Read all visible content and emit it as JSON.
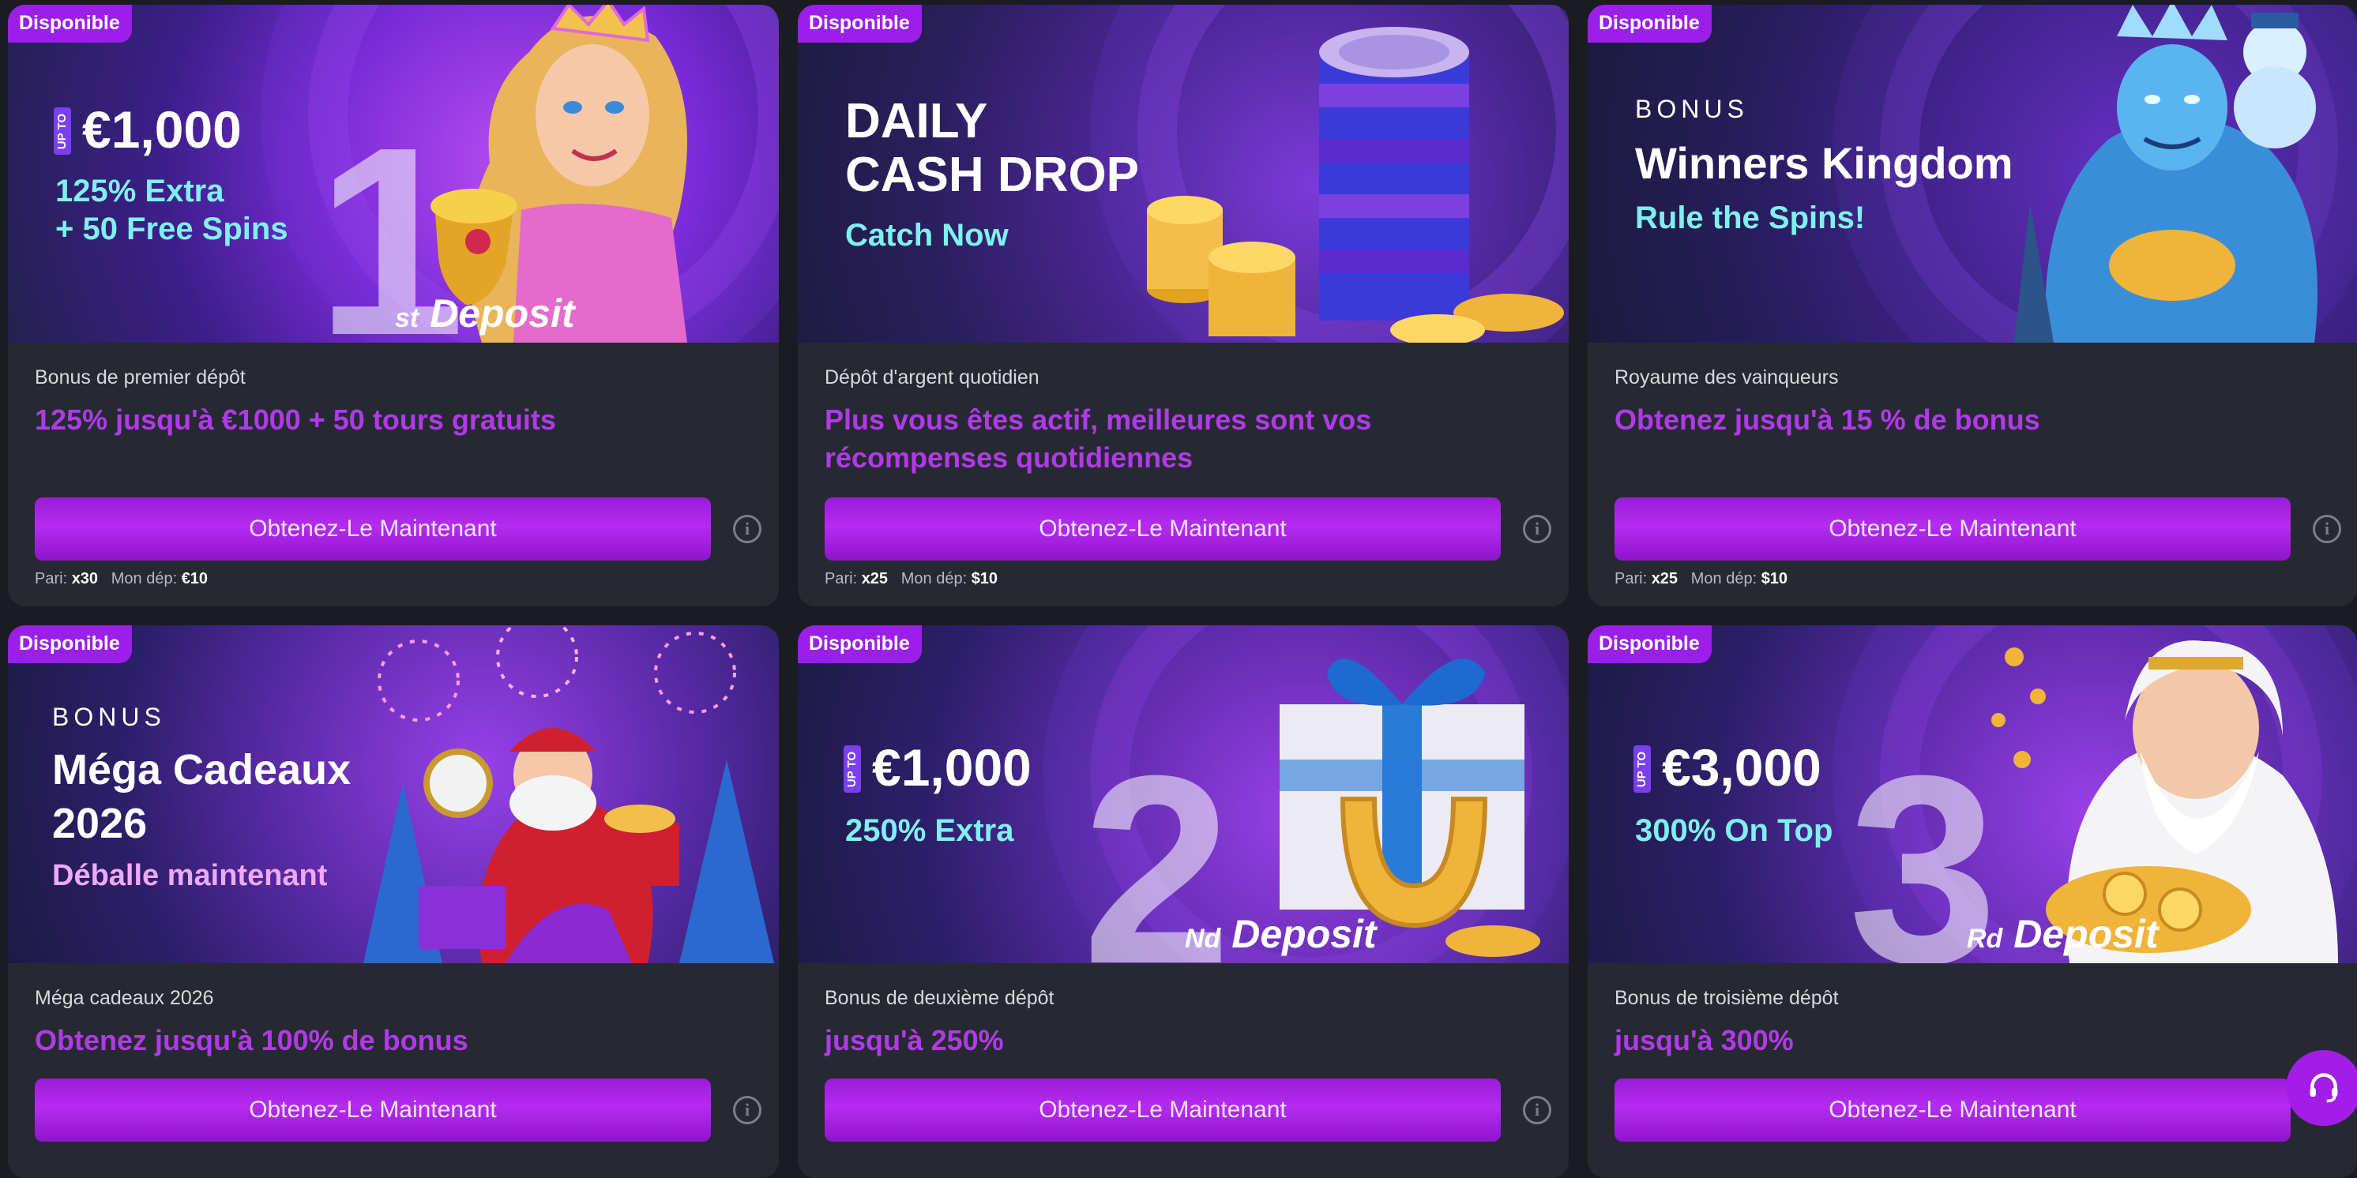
{
  "cards": [
    {
      "badge": "Disponible",
      "banner": {
        "upto": "UP TO",
        "amount": "€1,000",
        "line1": "125% Extra",
        "line2": "+ 50 Free Spins",
        "ghost": "1",
        "deposit_sup": "st",
        "deposit": "Deposit"
      },
      "title": "Bonus de premier dépôt",
      "description": "125% jusqu'à €1000 + 50 tours gratuits",
      "cta": "Obtenez-Le Maintenant",
      "wager_label": "Pari:",
      "wager": "x30",
      "min_label": "Mon dép:",
      "min": "€10"
    },
    {
      "badge": "Disponible",
      "banner": {
        "line1": "DAILY",
        "line2": "CASH DROP",
        "line3": "Catch Now"
      },
      "title": "Dépôt d'argent quotidien",
      "description": "Plus vous êtes actif, meilleures sont vos récompenses quotidiennes",
      "cta": "Obtenez-Le Maintenant",
      "wager_label": "Pari:",
      "wager": "x25",
      "min_label": "Mon dép:",
      "min": "$10"
    },
    {
      "badge": "Disponible",
      "banner": {
        "kicker": "BONUS",
        "line1": "Winners Kingdom",
        "line2": "Rule the Spins!"
      },
      "title": "Royaume des vainqueurs",
      "description": "Obtenez jusqu'à 15 % de bonus",
      "cta": "Obtenez-Le Maintenant",
      "wager_label": "Pari:",
      "wager": "x25",
      "min_label": "Mon dép:",
      "min": "$10"
    },
    {
      "badge": "Disponible",
      "banner": {
        "kicker": "BONUS",
        "line1": "Méga Cadeaux",
        "line2": "2026",
        "line3": "Déballe maintenant"
      },
      "title": "Méga cadeaux 2026",
      "description": "Obtenez jusqu'à 100% de bonus",
      "cta": "Obtenez-Le Maintenant"
    },
    {
      "badge": "Disponible",
      "banner": {
        "upto": "UP TO",
        "amount": "€1,000",
        "line1": "250% Extra",
        "ghost": "2",
        "deposit_sup": "Nd",
        "deposit": "Deposit"
      },
      "title": "Bonus de deuxième dépôt",
      "description": "jusqu'à 250%",
      "cta": "Obtenez-Le Maintenant"
    },
    {
      "badge": "Disponible",
      "banner": {
        "upto": "UP TO",
        "amount": "€3,000",
        "line1": "300% On Top",
        "ghost": "3",
        "deposit_sup": "Rd",
        "deposit": "Deposit"
      },
      "title": "Bonus de troisième dépôt",
      "description": "jusqu'à 300%",
      "cta": "Obtenez-Le Maintenant"
    }
  ],
  "colors": {
    "accent": "#a21ee8",
    "banner_cyan": "#7ff0f0",
    "page_bg": "#1a1c22",
    "card_bg": "#262932"
  },
  "support_icon": "headset-icon"
}
